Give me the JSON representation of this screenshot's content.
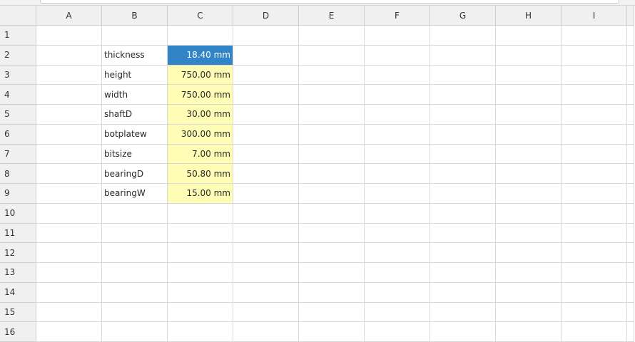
{
  "columns": [
    "A",
    "B",
    "C",
    "D",
    "E",
    "F",
    "G",
    "H",
    "I"
  ],
  "rows": [
    "1",
    "2",
    "3",
    "4",
    "5",
    "6",
    "7",
    "8",
    "9",
    "10",
    "11",
    "12",
    "13",
    "14",
    "15",
    "16"
  ],
  "parameters": [
    {
      "name": "thickness",
      "value": "18.40 mm"
    },
    {
      "name": "height",
      "value": "750.00 mm"
    },
    {
      "name": "width",
      "value": "750.00 mm"
    },
    {
      "name": "shaftD",
      "value": "30.00 mm"
    },
    {
      "name": "botplatew",
      "value": "300.00 mm"
    },
    {
      "name": "bitsize",
      "value": "7.00 mm"
    },
    {
      "name": "bearingD",
      "value": "50.80 mm"
    },
    {
      "name": "bearingW",
      "value": "15.00 mm"
    }
  ],
  "colors": {
    "parameter_fill": "#fffcb5",
    "selection_fill": "#3185c6",
    "header_fill": "#f0f0f0"
  }
}
